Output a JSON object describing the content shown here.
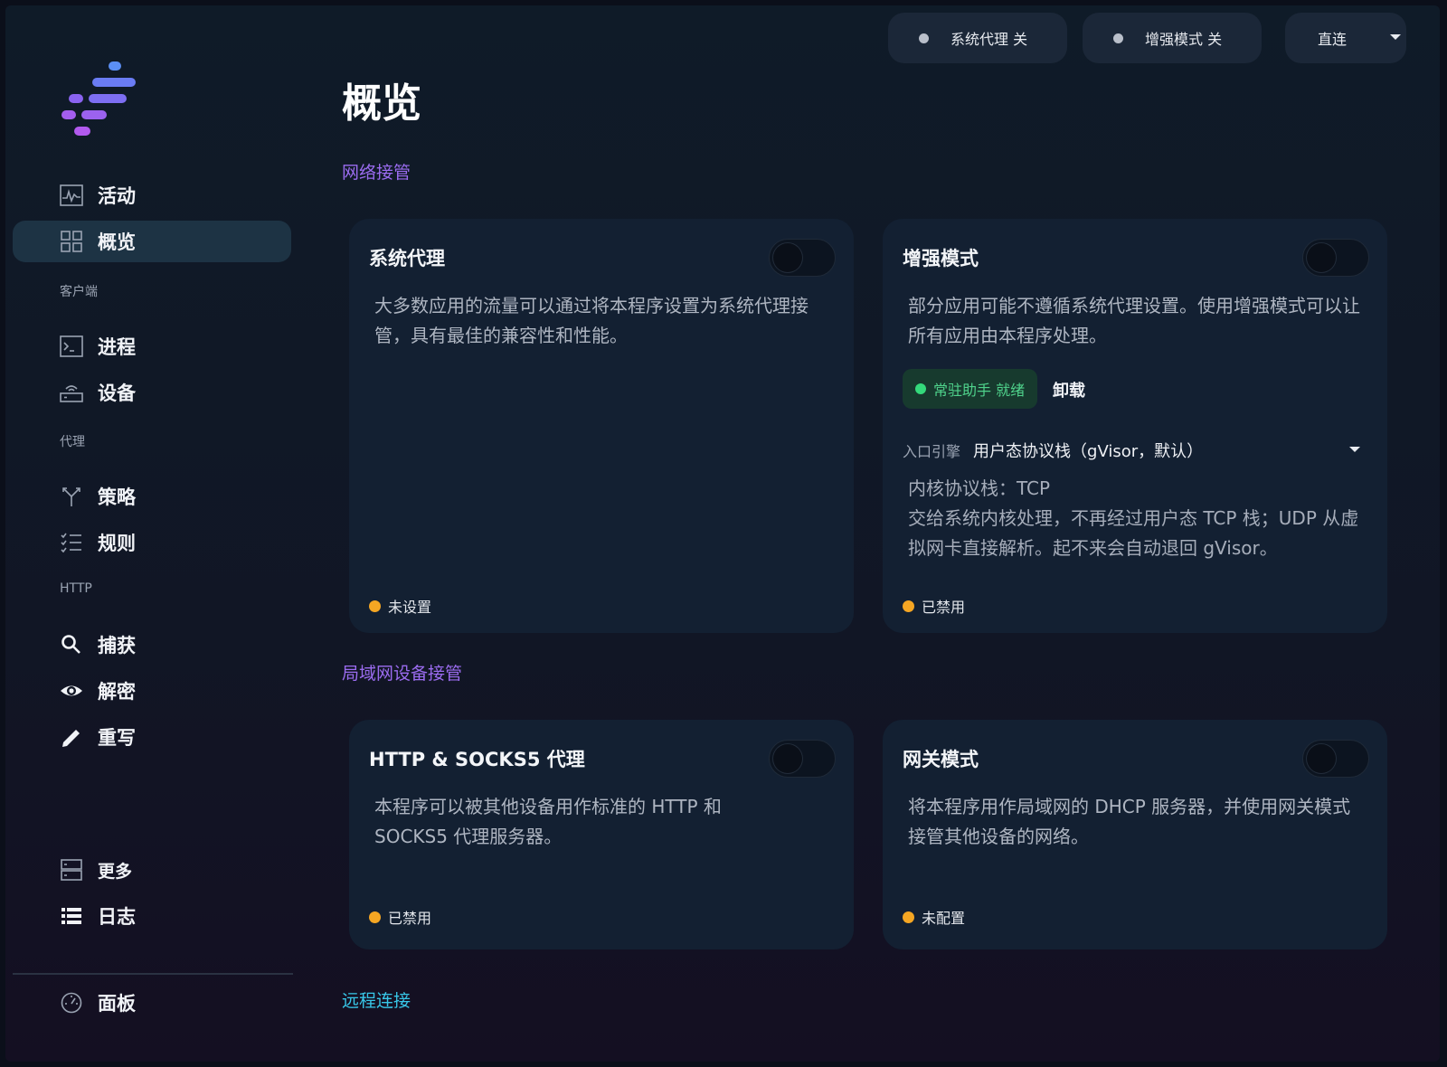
{
  "colors": {
    "accent_purple": "#9b6cf0",
    "accent_cyan": "#38c7e8",
    "status_orange": "#f5a623",
    "status_green": "#34d97b"
  },
  "sidebar": {
    "nav_top": [
      {
        "label": "活动",
        "icon": "activity-chart-icon"
      },
      {
        "label": "概览",
        "icon": "grid-icon",
        "active": true
      }
    ],
    "section_client": "客户端",
    "client_items": [
      {
        "label": "进程",
        "icon": "terminal-icon"
      },
      {
        "label": "设备",
        "icon": "router-icon"
      }
    ],
    "section_proxy": "代理",
    "proxy_items": [
      {
        "label": "策略",
        "icon": "fork-icon"
      },
      {
        "label": "规则",
        "icon": "checklist-icon"
      }
    ],
    "section_http": "HTTP",
    "http_items": [
      {
        "label": "捕获",
        "icon": "search-icon"
      },
      {
        "label": "解密",
        "icon": "eye-icon"
      },
      {
        "label": "重写",
        "icon": "pencil-icon"
      }
    ],
    "bottom_items": [
      {
        "label": "更多",
        "icon": "server-icon"
      },
      {
        "label": "日志",
        "icon": "list-icon"
      }
    ],
    "footer_item": {
      "label": "面板",
      "icon": "dashboard-icon"
    }
  },
  "topbar": {
    "system_proxy": "系统代理 关",
    "enhanced_mode": "增强模式 关",
    "mode_select": "直连"
  },
  "main": {
    "title": "概览",
    "section_network": "网络接管",
    "section_lan": "局域网设备接管",
    "section_remote": "远程连接",
    "cards": {
      "system_proxy": {
        "title": "系统代理",
        "desc": "大多数应用的流量可以通过将本程序设置为系统代理接管，具有最佳的兼容性和性能。",
        "status": "未设置",
        "enabled": false
      },
      "enhanced": {
        "title": "增强模式",
        "desc": "部分应用可能不遵循系统代理设置。使用增强模式可以让所有应用由本程序处理。",
        "helper_badge": "常驻助手 就绪",
        "uninstall": "卸载",
        "engine_label": "入口引擎",
        "engine_value": "用户态协议栈（gVisor，默认）",
        "engine_desc_line1": "内核协议栈：TCP",
        "engine_desc_line2": "交给系统内核处理，不再经过用户态 TCP 栈；UDP 从虚拟网卡直接解析。起不来会自动退回 gVisor。",
        "status": "已禁用",
        "enabled": false
      },
      "http_socks": {
        "title": "HTTP & SOCKS5 代理",
        "desc": "本程序可以被其他设备用作标准的 HTTP 和 SOCKS5 代理服务器。",
        "status": "已禁用",
        "enabled": false
      },
      "gateway": {
        "title": "网关模式",
        "desc": "将本程序用作局域网的 DHCP 服务器，并使用网关模式接管其他设备的网络。",
        "status": "未配置",
        "enabled": false
      }
    }
  }
}
